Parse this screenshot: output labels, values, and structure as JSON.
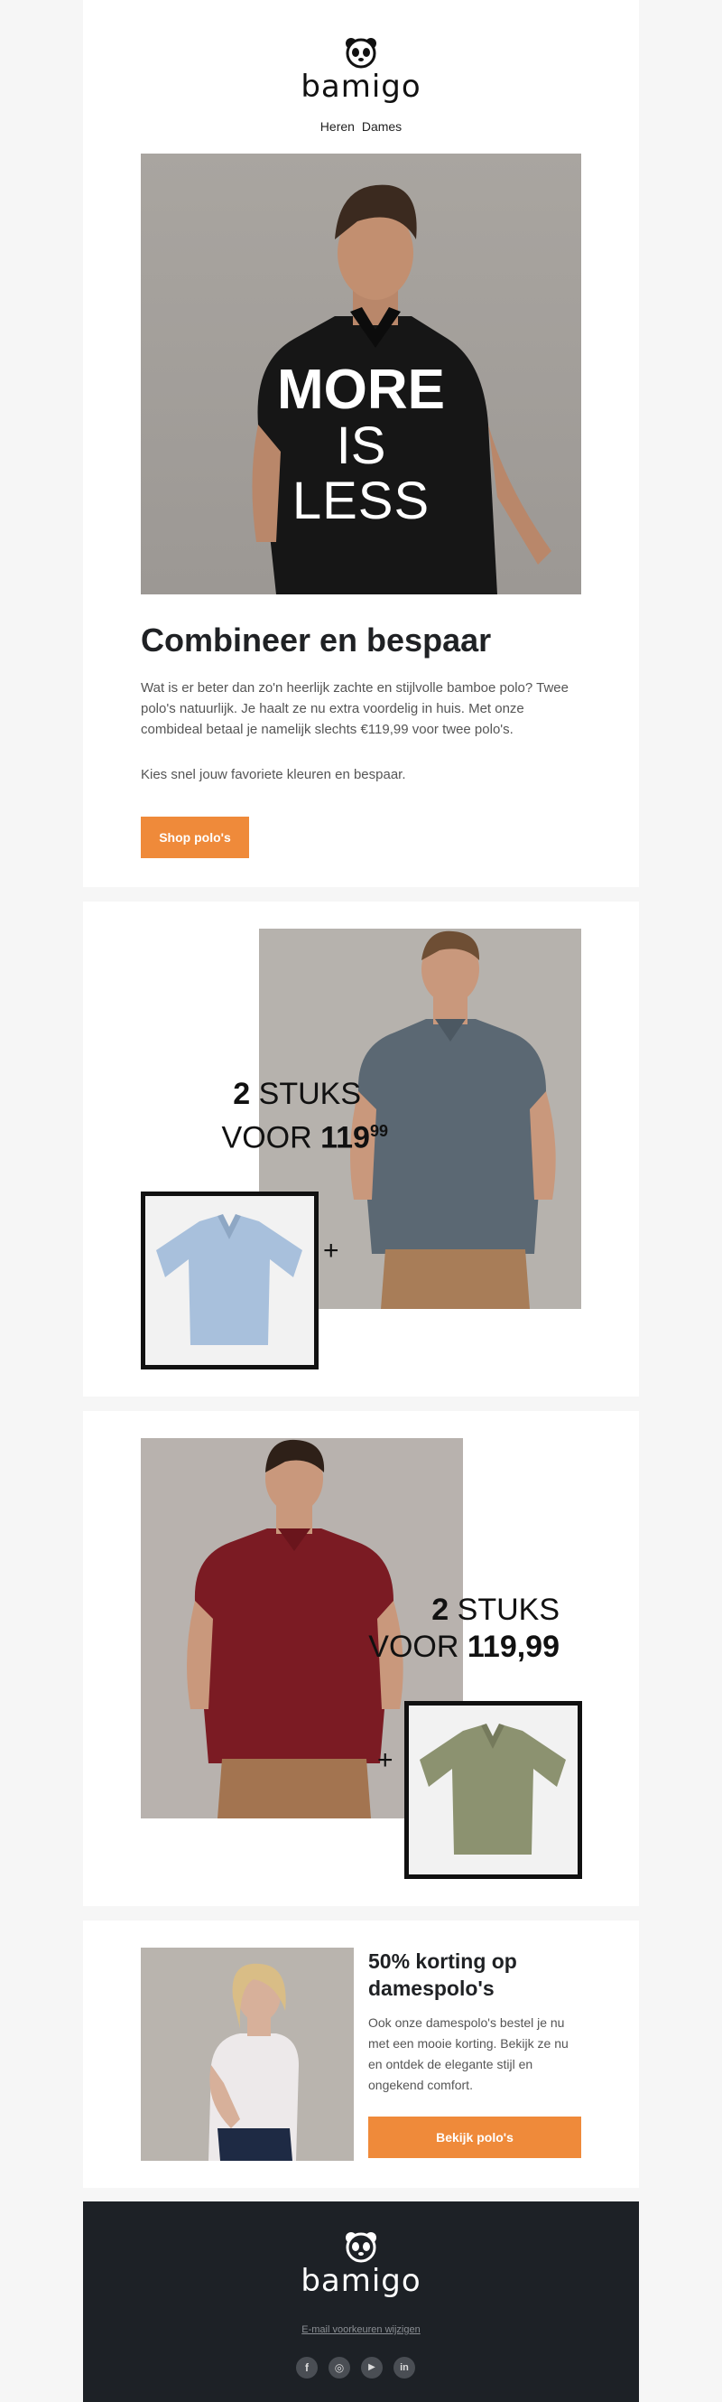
{
  "header": {
    "brand": "bamigo",
    "nav": [
      "Heren",
      "Dames"
    ]
  },
  "hero": {
    "line1": "MORE",
    "line2": "IS",
    "line3": "LESS"
  },
  "intro": {
    "title": "Combineer en bespaar",
    "paragraph1": "Wat is er beter dan zo'n heerlijk zachte en stijlvolle bamboe polo? Twee polo's natuurlijk. Je haalt ze nu extra voordelig in huis. Met onze combideal betaal je namelijk slechts €119,99 voor twee polo's.",
    "paragraph2": "Kies snel jouw favoriete kleuren en bespaar.",
    "cta": "Shop polo's"
  },
  "deal1": {
    "count": "2",
    "unit": "STUKS",
    "voor": "VOOR",
    "price_main": "119",
    "price_cents": "99",
    "plus": "+"
  },
  "deal2": {
    "count": "2",
    "unit": "STUKS",
    "voor": "VOOR",
    "price": "119,99",
    "plus": "+"
  },
  "promo": {
    "title": "50% korting op damespolo's",
    "text": "Ook onze damespolo's bestel je nu met een mooie korting. Bekijk ze nu en ontdek de elegante stijl en ongekend comfort.",
    "cta": "Bekijk polo's"
  },
  "footer": {
    "brand": "bamigo",
    "link": "E-mail voorkeuren wijzigen",
    "social": [
      "f",
      "◎",
      "▶",
      "in"
    ]
  },
  "colors": {
    "accent": "#ef8a3a",
    "footer_bg": "#1d2126",
    "page_bg": "#f6f6f6"
  }
}
